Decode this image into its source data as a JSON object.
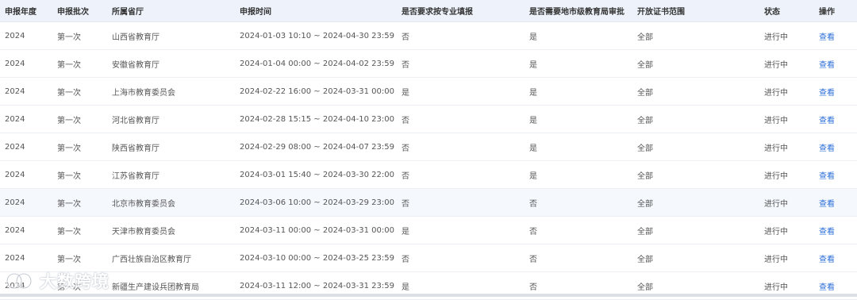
{
  "headers": [
    "申报年度",
    "申报批次",
    "所属省厅",
    "申报时间",
    "是否要求按专业填报",
    "是否需要地市级教育局审批",
    "开放证书范围",
    "状态",
    "操作"
  ],
  "rows": [
    [
      "2024",
      "第一次",
      "山西省教育厅",
      "2024-01-03 10:10 ~ 2024-04-30 23:59",
      "否",
      "是",
      "全部",
      "进行中",
      "查看"
    ],
    [
      "2024",
      "第一次",
      "安徽省教育厅",
      "2024-01-04 00:00 ~ 2024-04-02 23:59",
      "否",
      "是",
      "全部",
      "进行中",
      "查看"
    ],
    [
      "2024",
      "第一次",
      "上海市教育委员会",
      "2024-02-22 16:00 ~ 2024-03-31 00:00",
      "是",
      "是",
      "全部",
      "进行中",
      "查看"
    ],
    [
      "2024",
      "第一次",
      "河北省教育厅",
      "2024-02-28 15:15 ~ 2024-04-10 23:00",
      "否",
      "是",
      "全部",
      "进行中",
      "查看"
    ],
    [
      "2024",
      "第一次",
      "陕西省教育厅",
      "2024-02-29 08:00 ~ 2024-04-07 23:59",
      "否",
      "是",
      "全部",
      "进行中",
      "查看"
    ],
    [
      "2024",
      "第一次",
      "江苏省教育厅",
      "2024-03-01 15:40 ~ 2024-03-30 22:00",
      "否",
      "是",
      "全部",
      "进行中",
      "查看"
    ],
    [
      "2024",
      "第一次",
      "北京市教育委员会",
      "2024-03-06 10:00 ~ 2024-03-29 23:00",
      "否",
      "否",
      "全部",
      "进行中",
      "查看"
    ],
    [
      "2024",
      "第一次",
      "天津市教育委员会",
      "2024-03-11 00:00 ~ 2024-03-31 00:00",
      "是",
      "否",
      "全部",
      "进行中",
      "查看"
    ],
    [
      "2024",
      "第一次",
      "广西壮族自治区教育厅",
      "2024-03-10 00:00 ~ 2024-03-25 23:59",
      "否",
      "否",
      "全部",
      "进行中",
      "查看"
    ],
    [
      "2024",
      "第一次",
      "新疆生产建设兵团教育局",
      "2024-03-11 12:00 ~ 2024-03-31 23:59",
      "是",
      "否",
      "全部",
      "进行中",
      "查看"
    ]
  ],
  "highlight_row": 6,
  "watermark": {
    "text": "大数跨境",
    "icon": "brand-logo-icon"
  },
  "colors": {
    "header_bg": "#eef3fb",
    "link": "#2d6fd8",
    "row_highlight": "#f5f8fd",
    "divider": "#ebeef5"
  }
}
